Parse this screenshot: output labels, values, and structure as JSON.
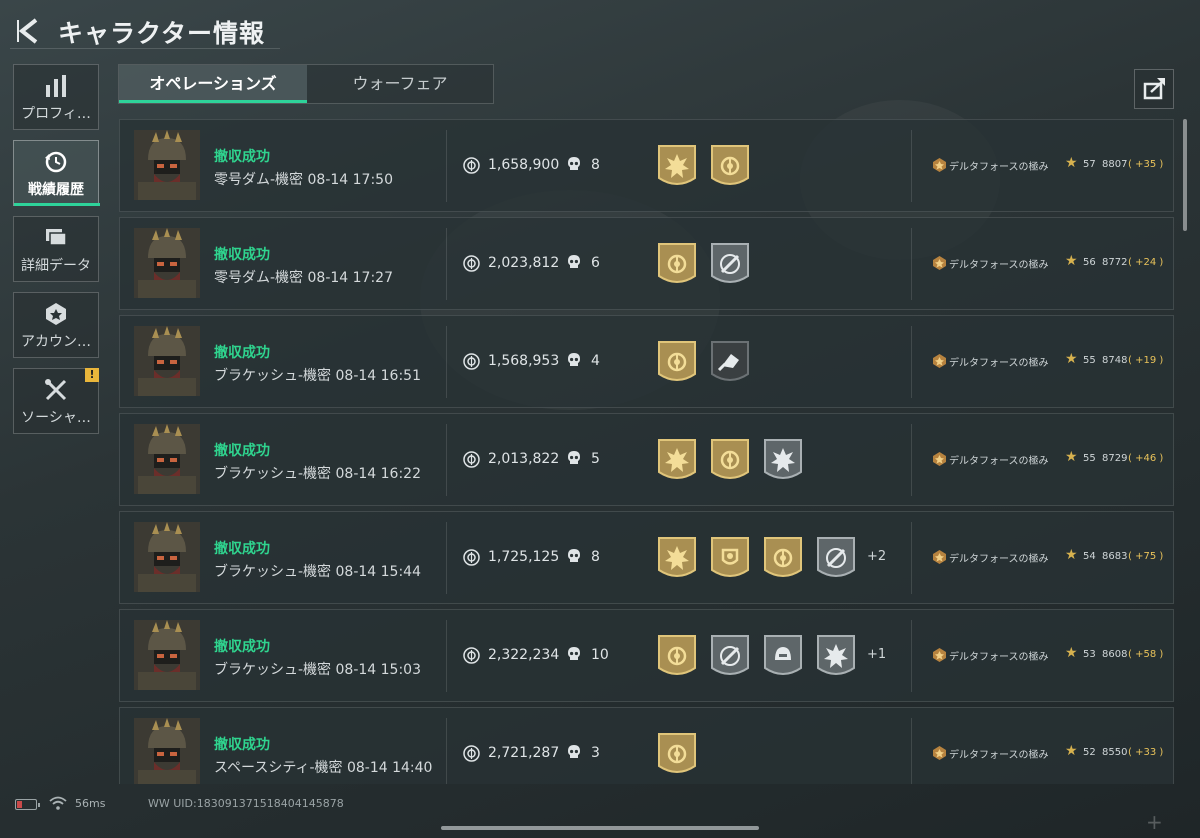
{
  "header": {
    "title": "キャラクター情報"
  },
  "sidebar": {
    "items": [
      {
        "label": "プロフィ…",
        "icon": "bar-chart-icon",
        "active": false
      },
      {
        "label": "戦績履歴",
        "icon": "history-icon",
        "active": true
      },
      {
        "label": "詳細データ",
        "icon": "folder-icon",
        "active": false
      },
      {
        "label": "アカウン…",
        "icon": "account-badge-icon",
        "active": false
      },
      {
        "label": "ソーシャ…",
        "icon": "tools-icon",
        "active": false,
        "notice": "!"
      }
    ]
  },
  "tabs": [
    {
      "label": "オペレーションズ",
      "active": true
    },
    {
      "label": "ウォーフェア",
      "active": false
    }
  ],
  "matches": [
    {
      "status": "撤収成功",
      "map": "零号ダム-機密 08-14 17:50",
      "value": "1,658,900",
      "kills": "8",
      "medals": [
        "gold-burst",
        "gold-emblem"
      ],
      "more": "",
      "rank": "デルタフォースの極み",
      "level": "57",
      "points": "8807",
      "delta": "( +35 )"
    },
    {
      "status": "撤収成功",
      "map": "零号ダム-機密 08-14 17:27",
      "value": "2,023,812",
      "kills": "6",
      "medals": [
        "gold-emblem",
        "silver-crosshair"
      ],
      "more": "",
      "rank": "デルタフォースの極み",
      "level": "56",
      "points": "8772",
      "delta": "( +24 )"
    },
    {
      "status": "撤収成功",
      "map": "ブラケッシュ-機密 08-14 16:51",
      "value": "1,568,953",
      "kills": "4",
      "medals": [
        "gold-emblem",
        "dark-hand"
      ],
      "more": "",
      "rank": "デルタフォースの極み",
      "level": "55",
      "points": "8748",
      "delta": "( +19 )"
    },
    {
      "status": "撤収成功",
      "map": "ブラケッシュ-機密 08-14 16:22",
      "value": "2,013,822",
      "kills": "5",
      "medals": [
        "gold-burst",
        "gold-emblem",
        "silver-burst"
      ],
      "more": "",
      "rank": "デルタフォースの極み",
      "level": "55",
      "points": "8729",
      "delta": "( +46 )"
    },
    {
      "status": "撤収成功",
      "map": "ブラケッシュ-機密 08-14 15:44",
      "value": "1,725,125",
      "kills": "8",
      "medals": [
        "gold-burst",
        "gold-shield",
        "gold-emblem",
        "silver-crosshair"
      ],
      "more": "+2",
      "rank": "デルタフォースの極み",
      "level": "54",
      "points": "8683",
      "delta": "( +75 )"
    },
    {
      "status": "撤収成功",
      "map": "ブラケッシュ-機密 08-14 15:03",
      "value": "2,322,234",
      "kills": "10",
      "medals": [
        "gold-emblem",
        "silver-crosshair",
        "silver-helmet",
        "silver-burst"
      ],
      "more": "+1",
      "rank": "デルタフォースの極み",
      "level": "53",
      "points": "8608",
      "delta": "( +58 )"
    },
    {
      "status": "撤収成功",
      "map": "スペースシティ-機密 08-14 14:40",
      "value": "2,721,287",
      "kills": "3",
      "medals": [
        "gold-emblem"
      ],
      "more": "",
      "rank": "デルタフォースの極み",
      "level": "52",
      "points": "8550",
      "delta": "( +33 )"
    }
  ],
  "footer": {
    "ping": "56ms",
    "uid": "WW UID:183091371518404145878",
    "battery_level": 0.25
  },
  "colors": {
    "accent": "#2ed39a",
    "success": "#2fd58f",
    "gold": "#c9a54a",
    "delta": "#e8c25a"
  }
}
